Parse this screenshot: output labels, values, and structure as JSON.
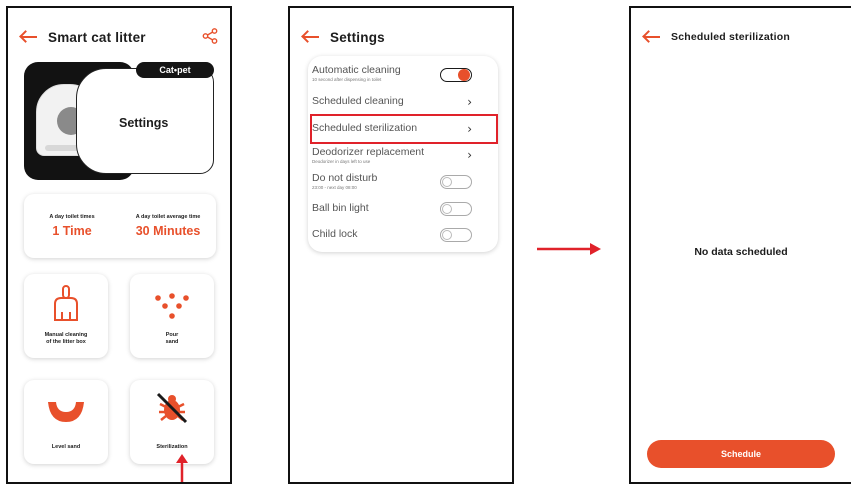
{
  "screen1": {
    "title": "Smart cat litter",
    "brand": "Cat•pet",
    "hero_label": "Settings",
    "stats": [
      {
        "label": "A day toilet times",
        "value": "1 Time"
      },
      {
        "label": "A day toilet average time",
        "value": "30 Minutes"
      }
    ],
    "tiles": [
      {
        "label_line1": "Manual cleaning",
        "label_line2": "of the litter box"
      },
      {
        "label_line1": "Pour",
        "label_line2": "sand"
      },
      {
        "label_line1": "Level sand",
        "label_line2": ""
      },
      {
        "label_line1": "Sterilization",
        "label_line2": ""
      }
    ]
  },
  "screen2": {
    "title": "Settings",
    "rows": [
      {
        "label": "Automatic cleaning",
        "sub": "10 second after dispensing in toilet",
        "control": "toggle",
        "on": true
      },
      {
        "label": "Scheduled cleaning",
        "sub": "",
        "control": "chevron"
      },
      {
        "label": "Scheduled sterilization",
        "sub": "",
        "control": "chevron"
      },
      {
        "label": "Deodorizer replacement",
        "sub": "Deodorizer in days left to use",
        "control": "chevron"
      },
      {
        "label": "Do not disturb",
        "sub": "23:00 - next day 08:00",
        "control": "toggle",
        "on": false
      },
      {
        "label": "Ball bin light",
        "sub": "",
        "control": "toggle",
        "on": false
      },
      {
        "label": "Child lock",
        "sub": "",
        "control": "toggle",
        "on": false
      }
    ]
  },
  "screen3": {
    "title": "Scheduled sterilization",
    "empty_message": "No data scheduled",
    "button_label": "Schedule"
  },
  "colors": {
    "accent": "#e8502b",
    "highlight": "#e0222a",
    "dark": "#121212"
  }
}
